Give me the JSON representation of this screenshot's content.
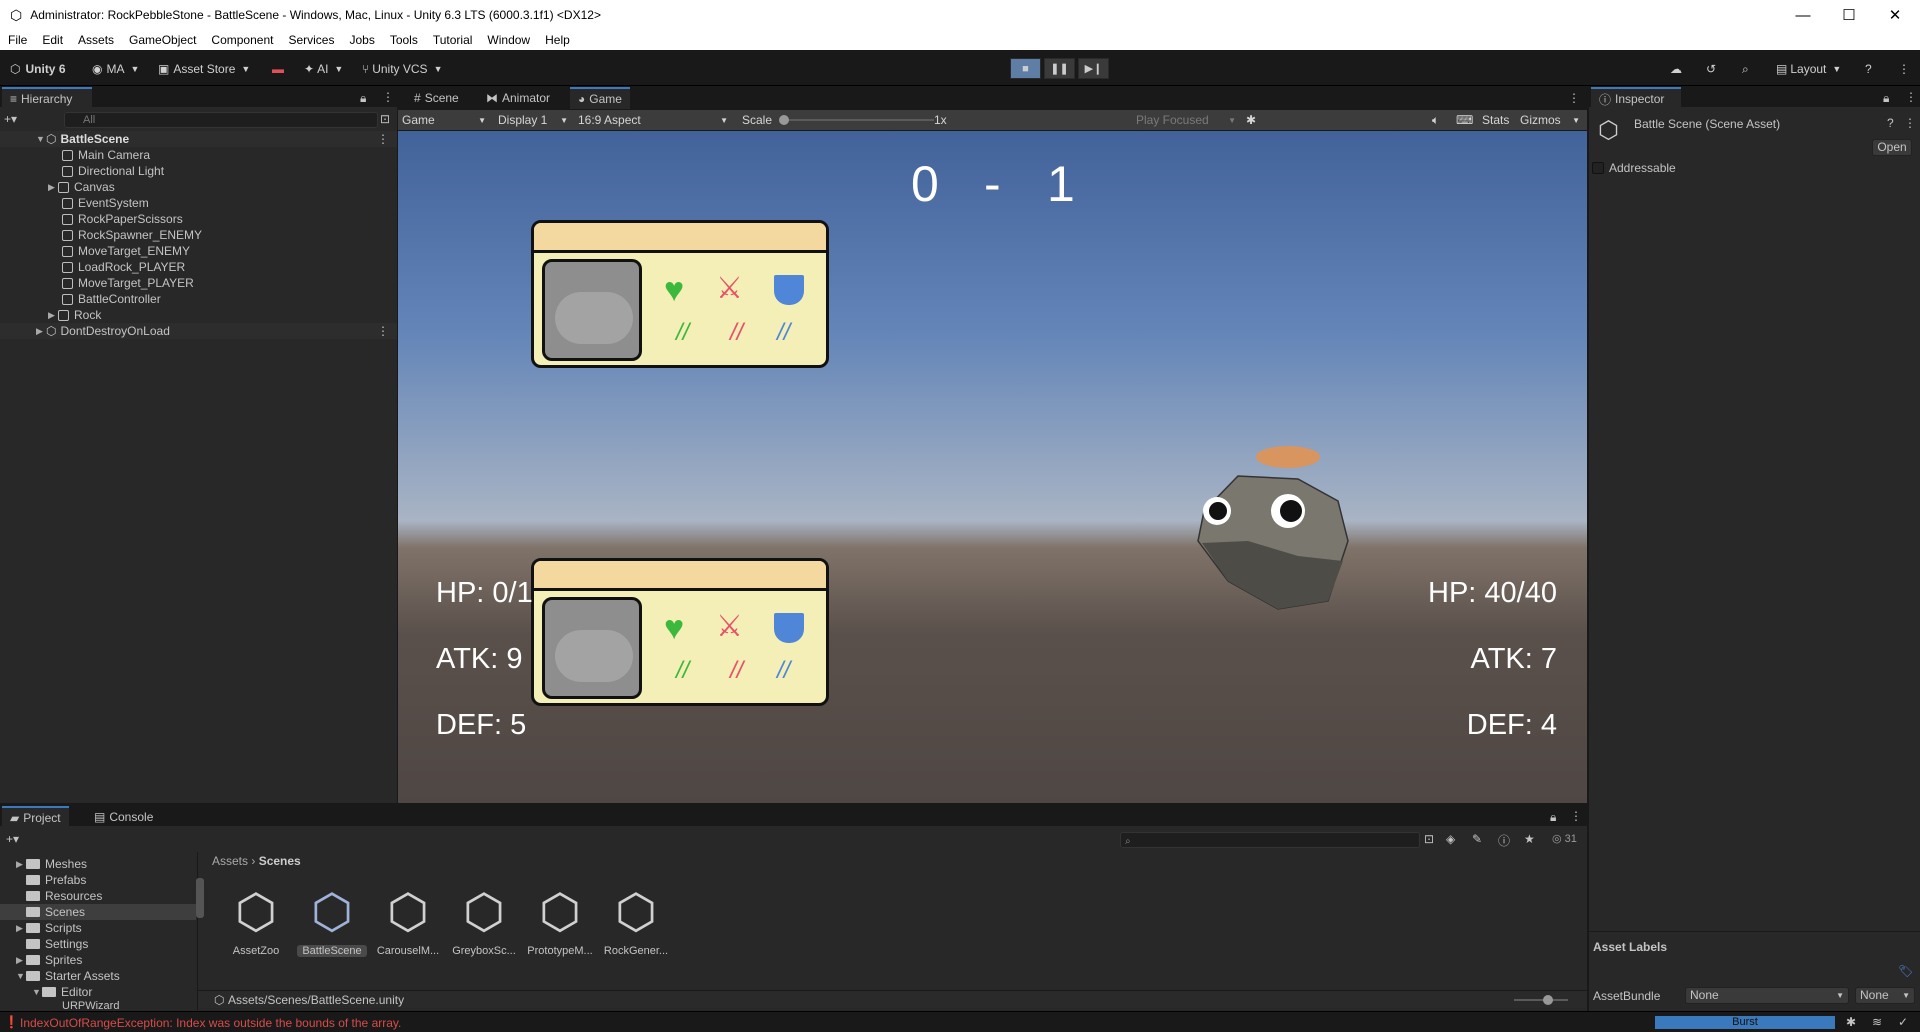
{
  "window": {
    "title": "Administrator: RockPebbleStone - BattleScene - Windows, Mac, Linux - Unity 6.3 LTS (6000.3.1f1) <DX12>"
  },
  "menu": [
    "File",
    "Edit",
    "Assets",
    "GameObject",
    "Component",
    "Services",
    "Jobs",
    "Tools",
    "Tutorial",
    "Window",
    "Help"
  ],
  "toolbar": {
    "unity": "Unity 6",
    "account": "MA",
    "asset_store": "Asset Store",
    "ai": "AI",
    "vcs": "Unity VCS",
    "layout": "Layout"
  },
  "hierarchy": {
    "tab": "Hierarchy",
    "search_placeholder": "All",
    "scene": "BattleScene",
    "items": [
      "Main Camera",
      "Directional Light",
      "Canvas",
      "EventSystem",
      "RockPaperScissors",
      "RockSpawner_ENEMY",
      "MoveTarget_ENEMY",
      "LoadRock_PLAYER",
      "MoveTarget_PLAYER",
      "BattleController",
      "Rock"
    ],
    "dont_destroy": "DontDestroyOnLoad"
  },
  "game_tabs": [
    "Scene",
    "Animator",
    "Game"
  ],
  "game_bar": {
    "mode": "Game",
    "display": "Display 1",
    "aspect": "16:9 Aspect",
    "scale_label": "Scale",
    "scale_value": "1x",
    "play_mode": "Play Focused",
    "stats": "Stats",
    "gizmos": "Gizmos"
  },
  "game": {
    "score_left": "0",
    "score_dash": "-",
    "score_right": "1",
    "player": {
      "hp": "HP: 0/1",
      "atk": "ATK: 9",
      "def": "DEF: 5"
    },
    "enemy": {
      "hp": "HP: 40/40",
      "atk": "ATK: 7",
      "def": "DEF: 4"
    },
    "card_marks": [
      "//",
      "//",
      "//"
    ]
  },
  "inspector": {
    "tab": "Inspector",
    "title": "Battle Scene (Scene Asset)",
    "open": "Open",
    "addressable": "Addressable",
    "asset_labels": "Asset Labels",
    "asset_bundle_label": "AssetBundle",
    "asset_bundle_value": "None",
    "asset_bundle_variant": "None"
  },
  "project": {
    "tabs": [
      "Project",
      "Console"
    ],
    "folders": [
      "Meshes",
      "Prefabs",
      "Resources",
      "Scenes",
      "Scripts",
      "Settings",
      "Sprites",
      "Starter Assets",
      "Editor",
      "URPWizard"
    ],
    "breadcrumb_root": "Assets",
    "breadcrumb_current": "Scenes",
    "assets": [
      "AssetZoo",
      "BattleScene",
      "CarouselM...",
      "GreyboxSc...",
      "PrototypeM...",
      "RockGener..."
    ],
    "path": "Assets/Scenes/BattleScene.unity",
    "count": "31"
  },
  "status": {
    "error": "IndexOutOfRangeException: Index was outside the bounds of the array.",
    "burst": "Burst"
  },
  "colors": {
    "accent": "#3a79bb",
    "error": "#d84b4b",
    "heart": "#3cb83c",
    "sword": "#e8506a",
    "shield": "#4f86d8"
  }
}
